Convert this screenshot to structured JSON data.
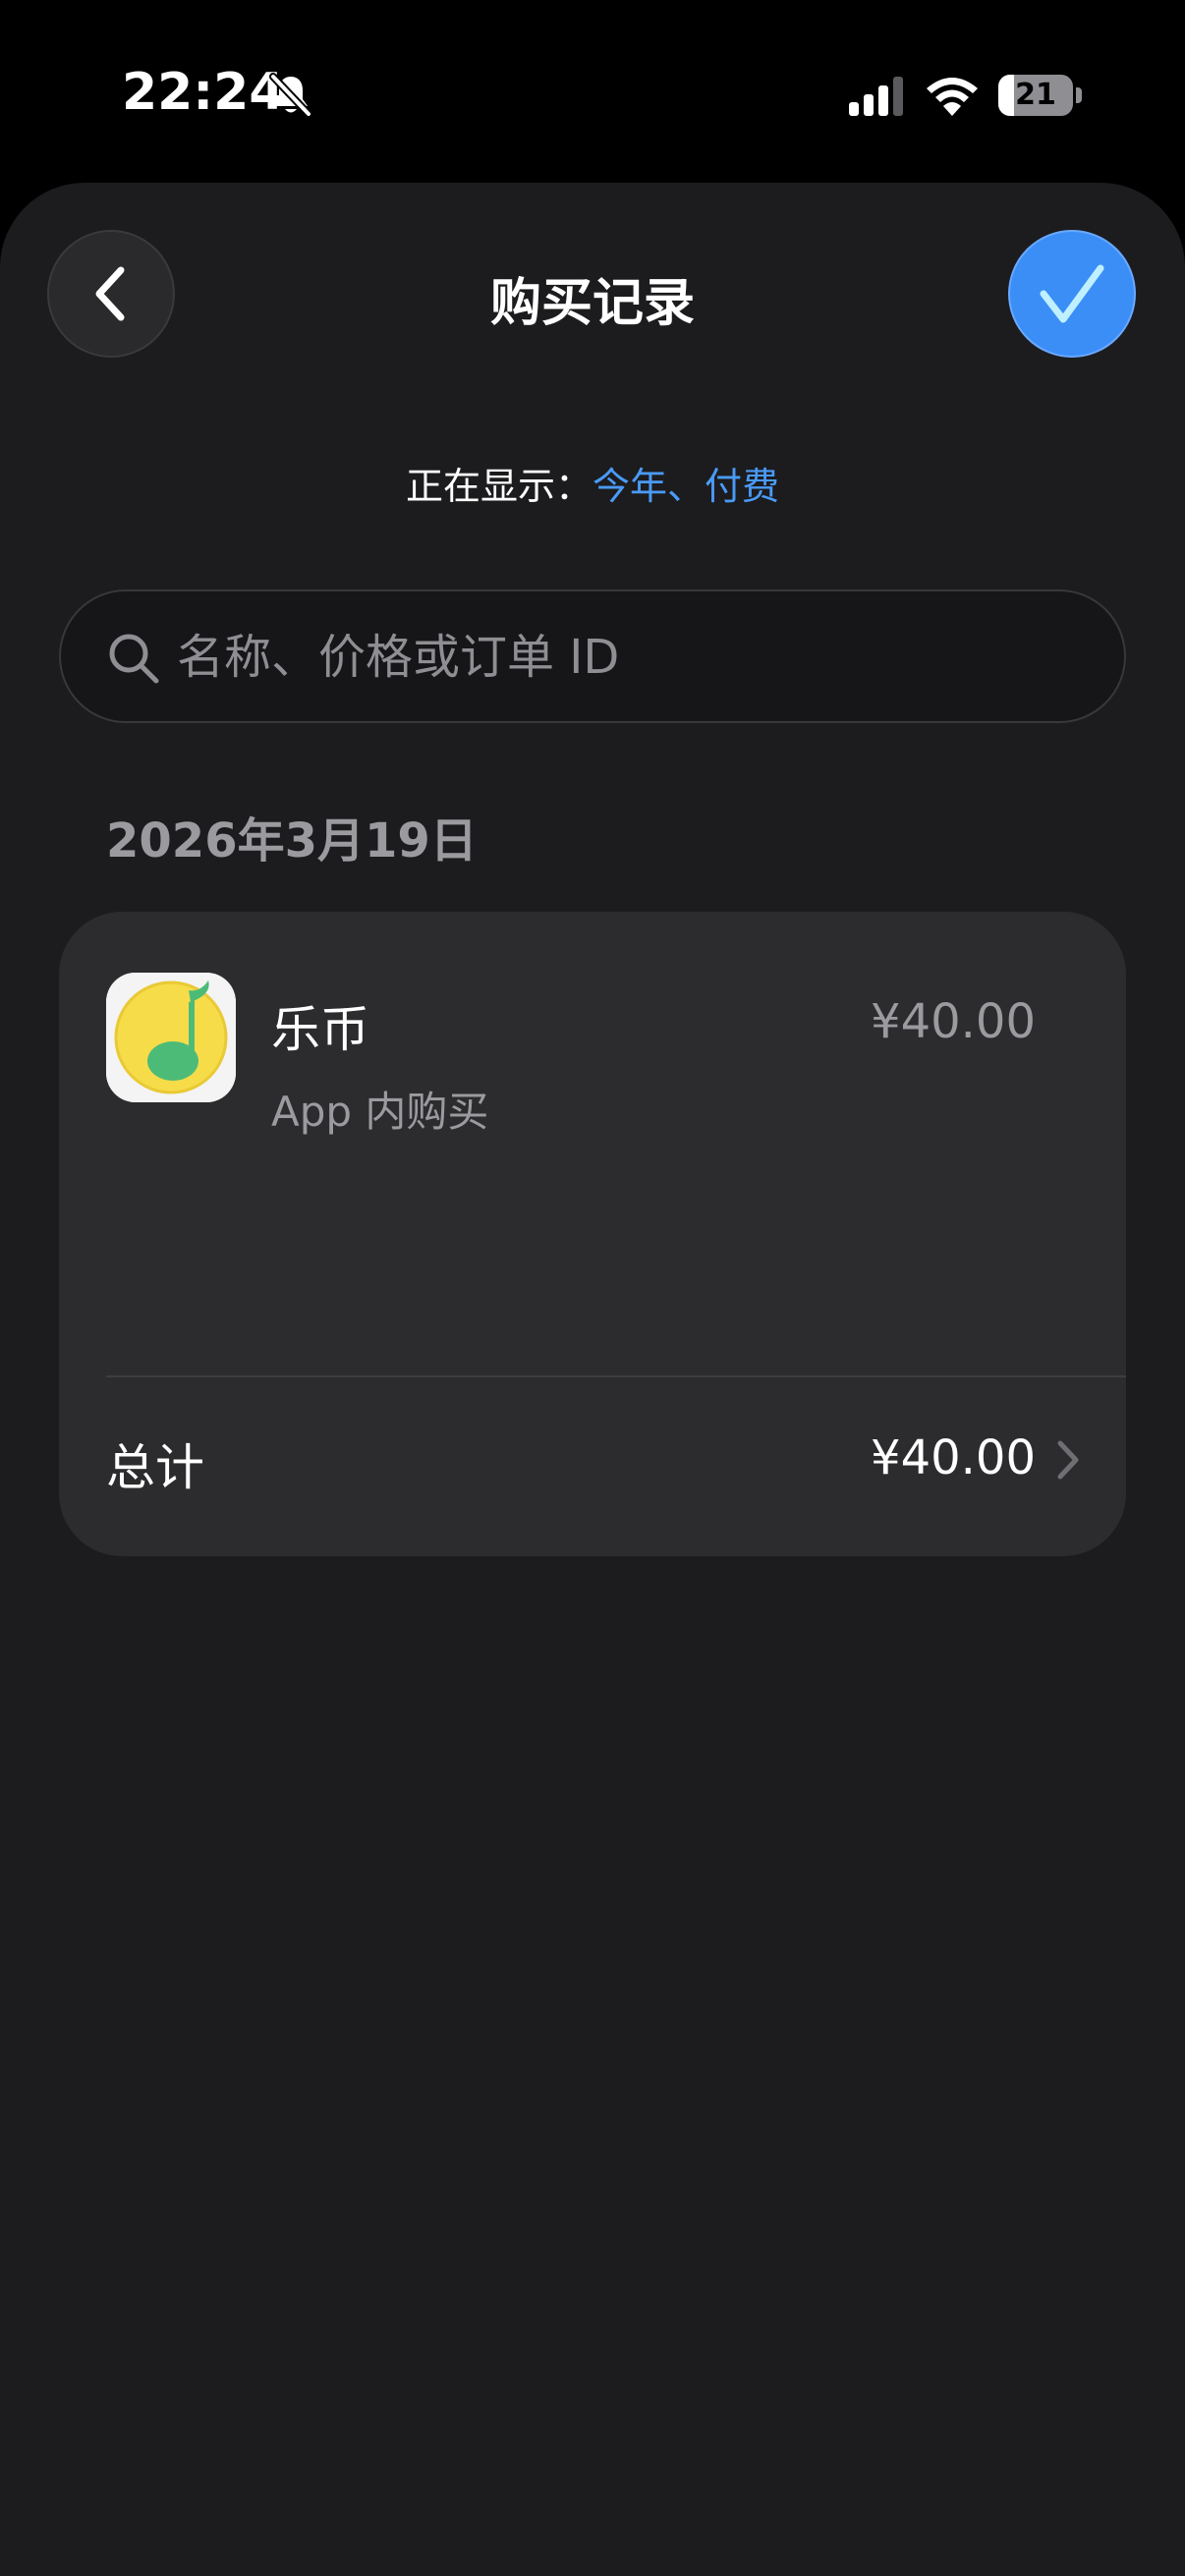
{
  "status_bar": {
    "time": "22:24",
    "battery_level": "21",
    "battery_fraction": 0.21,
    "icons": [
      "bell-slash-icon",
      "cellular-signal-icon",
      "wifi-icon",
      "battery-icon"
    ]
  },
  "header": {
    "title": "购买记录",
    "back_icon": "chevron-left-icon",
    "confirm_icon": "checkmark-icon"
  },
  "filter": {
    "prefix": "正在显示：",
    "value": "今年、付费"
  },
  "search": {
    "placeholder": "名称、价格或订单 ID",
    "value": "",
    "icon": "search-icon"
  },
  "purchases": [
    {
      "date": "2026年3月19日",
      "items": [
        {
          "name": "乐币",
          "type": "App 内购买",
          "price": "¥40.00",
          "icon": "music-note-app-icon"
        }
      ],
      "total_label": "总计",
      "total_value": "¥40.00"
    }
  ],
  "colors": {
    "background": "#000000",
    "sheet": "#1c1c1e",
    "card": "#2c2c2e",
    "accent": "#4a9bf7",
    "confirm": "#3a8ef6",
    "secondary_text": "#9a9a9f"
  }
}
